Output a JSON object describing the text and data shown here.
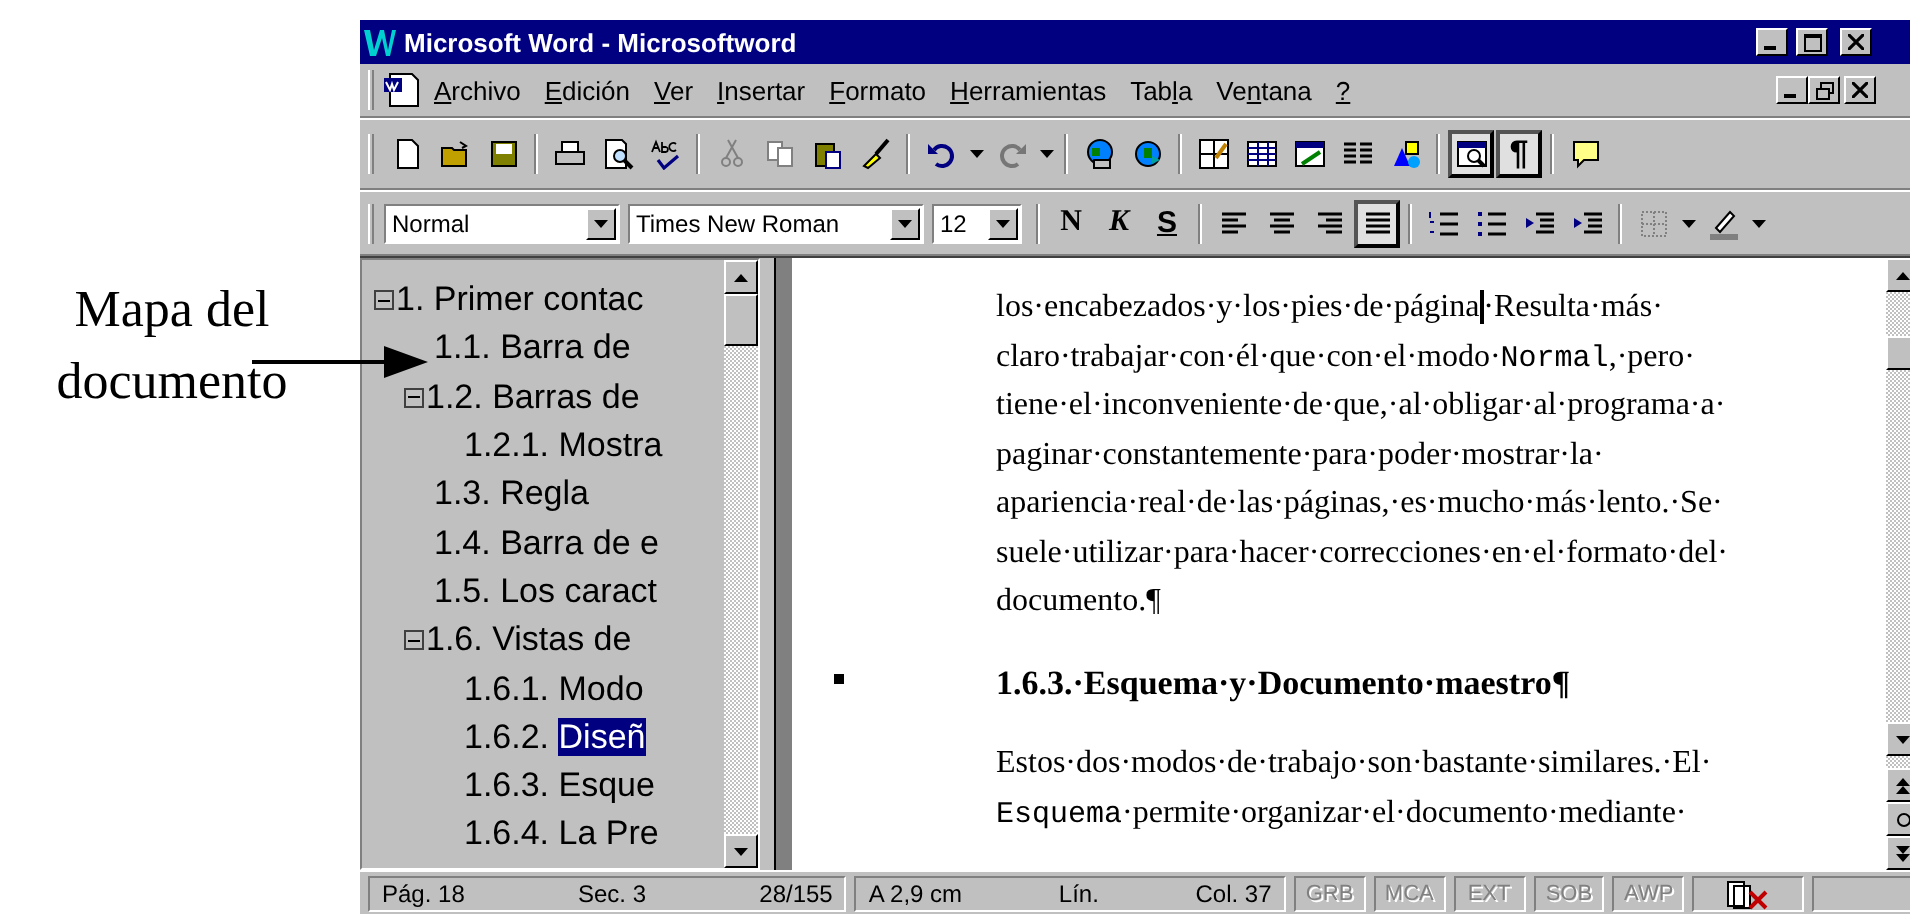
{
  "annotation": {
    "text": "Mapa del documento"
  },
  "window": {
    "title": "Microsoft Word - Microsoftword"
  },
  "menu": [
    "Archivo",
    "Edición",
    "Ver",
    "Insertar",
    "Formato",
    "Herramientas",
    "Tabla",
    "Ventana",
    "?"
  ],
  "standard_toolbar": [
    {
      "pressed": false,
      "disabled": false
    },
    {
      "pressed": false,
      "disabled": false
    },
    {
      "pressed": false,
      "disabled": false
    },
    {
      "pressed": false,
      "disabled": false
    },
    {
      "pressed": false,
      "disabled": false
    },
    {
      "pressed": false,
      "disabled": false
    },
    {
      "pressed": false,
      "disabled": false
    },
    {
      "pressed": false,
      "disabled": false
    },
    {
      "pressed": false,
      "disabled": false
    },
    {
      "pressed": false,
      "disabled": false
    },
    {
      "pressed": false,
      "disabled": false
    },
    {
      "pressed": false,
      "disabled": true
    },
    {
      "pressed": false,
      "disabled": false
    },
    {
      "pressed": false,
      "disabled": false
    },
    {
      "pressed": false,
      "disabled": false
    },
    {
      "pressed": false,
      "disabled": false
    },
    {
      "pressed": false,
      "disabled": false
    },
    {
      "pressed": false,
      "disabled": false
    },
    {
      "pressed": false,
      "disabled": false
    },
    {
      "pressed": true,
      "disabled": false
    },
    {
      "pressed": true,
      "disabled": false,
      "label": "¶"
    },
    {
      "pressed": false,
      "disabled": false
    }
  ],
  "formatting_toolbar": {
    "style": "Normal",
    "font": "Times New Roman",
    "size": "12",
    "buttons": [
      {
        "label": "N",
        "pressed": false
      },
      {
        "label": "K",
        "pressed": false
      },
      {
        "label": "S",
        "pressed": false
      },
      {
        "pressed": false
      },
      {
        "pressed": false
      },
      {
        "pressed": false
      },
      {
        "pressed": true
      },
      {
        "pressed": false
      },
      {
        "pressed": false
      },
      {
        "pressed": false
      },
      {
        "pressed": false
      },
      {
        "pressed": false
      },
      {
        "pressed": false
      }
    ]
  },
  "document_map": [
    {
      "label": "1. Primer contac",
      "expanded": true,
      "selected": false,
      "children": [
        {
          "label": "1.1. Barra de",
          "selected": false
        },
        {
          "label": "1.2. Barras de",
          "expanded": true,
          "selected": false,
          "children": [
            {
              "label": "1.2.1. Mostra",
              "selected": false
            }
          ]
        },
        {
          "label": "1.3. Regla",
          "selected": false
        },
        {
          "label": "1.4. Barra de e",
          "selected": false
        },
        {
          "label": "1.5. Los caract",
          "selected": false
        },
        {
          "label": "1.6. Vistas de",
          "expanded": true,
          "selected": false,
          "children": [
            {
              "label": "1.6.1. Modo",
              "selected": false
            },
            {
              "label": "1.6.2.",
              "highlight": "Diseñ",
              "selected": true
            },
            {
              "label": "1.6.3. Esque",
              "selected": false
            },
            {
              "label": "1.6.4. La Pre",
              "selected": false
            }
          ]
        }
      ]
    }
  ],
  "document": [
    {
      "kind": "paragraph",
      "lines": [
        [
          {
            "kind": "plain",
            "text": "los·encabezados·y·los·pies·de·página",
            "caret": true
          },
          {
            "kind": "plain",
            "text": "·Resulta·más·",
            "caret": false
          }
        ],
        [
          {
            "kind": "plain",
            "text": "claro·trabajar·con·él·que·con·el·modo·"
          },
          {
            "kind": "code",
            "text": "Normal"
          },
          {
            "kind": "plain",
            "text": ",·pero·"
          }
        ],
        [
          {
            "kind": "plain",
            "text": "tiene·el·inconveniente·de·que,·al·obligar·al·programa·a·"
          }
        ],
        [
          {
            "kind": "plain",
            "text": "paginar·constantemente·para·poder·mostrar·la·"
          }
        ],
        [
          {
            "kind": "plain",
            "text": "apariencia·real·de·las·páginas,·es·mucho·más·lento.·Se·"
          }
        ],
        [
          {
            "kind": "plain",
            "text": "suele·utilizar·para·hacer·correcciones·en·el·formato·del·"
          }
        ],
        [
          {
            "kind": "plain",
            "text": "documento.¶"
          }
        ]
      ]
    },
    {
      "kind": "heading",
      "lines": [
        [
          {
            "kind": "plain",
            "text": "1.6.3.·Esquema·y·Documento·maestro¶"
          }
        ]
      ]
    },
    {
      "kind": "paragraph",
      "lines": [
        [
          {
            "kind": "plain",
            "text": "Estos·dos·modos·de·trabajo·son·bastante·similares.·El·"
          }
        ],
        [
          {
            "kind": "code",
            "text": "Esquema"
          },
          {
            "kind": "plain",
            "text": "·permite·organizar·el·documento·mediante·"
          }
        ]
      ]
    }
  ],
  "status_bar": {
    "groups": [
      [
        "Pág. 18",
        "Sec. 3",
        "28/155"
      ],
      [
        "A 2,9 cm",
        "Lín.",
        "Col. 37"
      ]
    ],
    "modes": [
      {
        "label": "GRB",
        "on": false
      },
      {
        "label": "MCA",
        "on": false
      },
      {
        "label": "EXT",
        "on": false
      },
      {
        "label": "SOB",
        "on": false
      },
      {
        "label": "AWP",
        "on": false
      }
    ]
  }
}
